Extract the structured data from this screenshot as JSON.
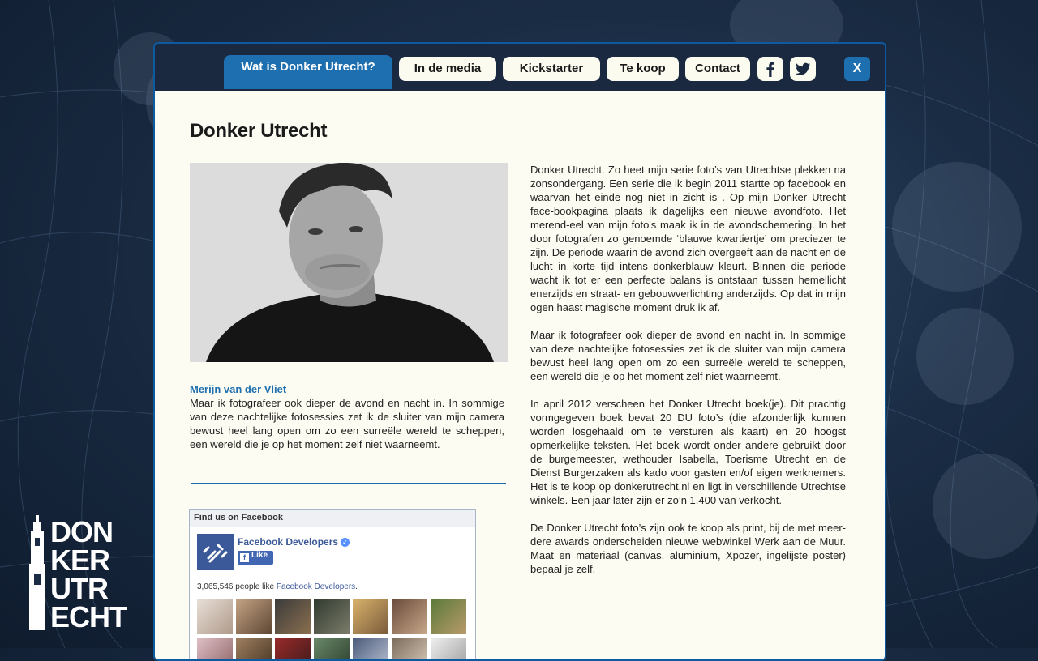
{
  "nav": {
    "tabs": [
      {
        "label": "Wat is Donker Utrecht?",
        "active": true
      },
      {
        "label": "In de media"
      },
      {
        "label": "Kickstarter"
      },
      {
        "label": "Te koop"
      },
      {
        "label": "Contact"
      }
    ],
    "social": [
      "facebook-icon",
      "twitter-icon"
    ],
    "close_label": "X"
  },
  "page": {
    "title": "Donker Utrecht",
    "caption_name": "Merijn van der Vliet",
    "caption_text": "Maar ik fotografeer ook dieper de avond en nacht in. In sommige van deze nachtelijke fotosessies zet ik de sluiter van mijn camera bewust heel lang open om zo een surreële wereld te scheppen, een wereld die je op het moment zelf niet waarneemt.",
    "paragraphs": [
      "Donker Utrecht. Zo heet mijn serie foto’s van Utrechtse plekken na zonsondergang. Een serie die ik begin 2011 startte op facebook en waarvan het einde nog niet in zicht is . Op mijn Donker Utrecht face-bookpagina plaats ik dagelijks een nieuwe avondfoto. Het merend-eel van mijn foto's maak ik in de avondschemering. In het door fotografen zo genoemde ‘blauwe kwartiertje’ om preciezer te zijn. De periode waarin de avond zich overgeeft aan de nacht en de lucht in korte tijd intens donkerblauw kleurt. Binnen die periode wacht ik tot er een perfecte balans is ontstaan tussen hemellicht enerzijds en straat- en gebouwverlichting anderzijds. Op dat in mijn ogen haast magische moment druk ik af.",
      "Maar ik fotografeer ook dieper de avond en nacht in. In sommige van deze nachtelijke fotosessies zet ik de sluiter van mijn camera bewust heel lang open om zo een surreële wereld te scheppen, een wereld die je op het moment zelf niet waarneemt.",
      "In april 2012 verscheen het Donker Utrecht boek(je). Dit prachtig vormgegeven boek bevat 20 DU foto’s (die afzonderlijk kunnen worden losgehaald om te versturen als kaart) en 20 hoogst opmerkelijke teksten. Het boek wordt onder andere gebruikt door de burgemeester, wethouder Isabella, Toerisme Utrecht en de Dienst Burgerzaken als kado voor gasten en/of eigen werknemers. Het is te koop op donkerutrecht.nl en ligt in verschillende Utrechtse winkels. Een jaar later zijn er zo’n 1.400 van verkocht.",
      "De Donker Utrecht foto’s zijn ook te koop als print, bij de met meer-dere awards onderscheiden nieuwe webwinkel Werk aan de Muur. Maat en materiaal (canvas, aluminium, Xpozer, ingelijste poster) bepaal je zelf."
    ]
  },
  "facebook": {
    "header": "Find us on Facebook",
    "page_name": "Facebook Developers",
    "like_label": "Like",
    "count": "3,065,546",
    "count_suffix": " people like ",
    "count_link": "Facebook Developers",
    "count_end": "."
  },
  "logo": {
    "lines": [
      "DON",
      "KER",
      "UTR",
      "ECHT"
    ]
  },
  "colors": {
    "accent": "#1e6fb0",
    "panel_bg": "#fdfcf2",
    "nav_bg": "#1b2940"
  }
}
